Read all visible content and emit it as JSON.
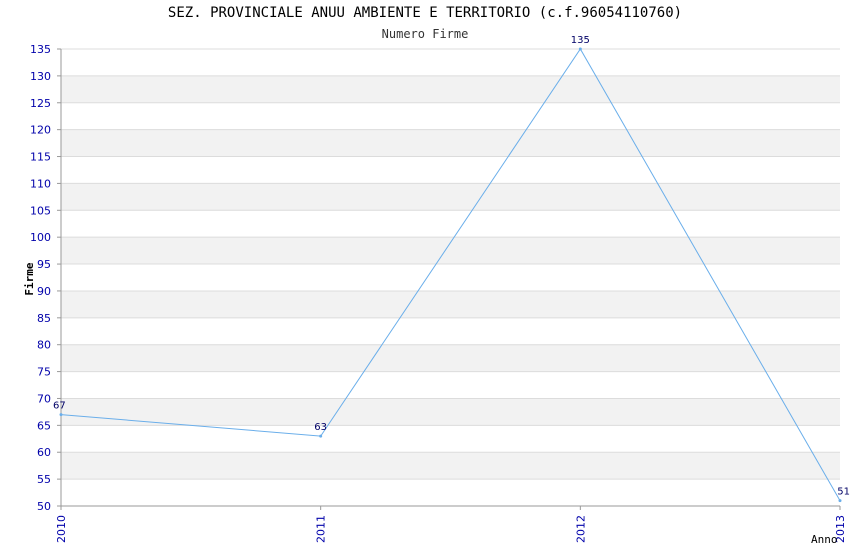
{
  "chart_data": {
    "type": "line",
    "title": "SEZ. PROVINCIALE ANUU AMBIENTE E TERRITORIO (c.f.96054110760)",
    "subtitle": "Numero Firme",
    "xlabel": "Anno",
    "ylabel": "Firme",
    "x": [
      "2010",
      "2011",
      "2012",
      "2013"
    ],
    "series": [
      {
        "values": [
          67,
          63,
          135,
          51
        ]
      }
    ],
    "ylim": [
      50,
      135
    ],
    "yticks": [
      50,
      55,
      60,
      65,
      70,
      75,
      80,
      85,
      90,
      95,
      100,
      105,
      110,
      115,
      120,
      125,
      130,
      135
    ],
    "grid": true,
    "colors": {
      "line": "#6aaeea",
      "band": "#f2f2f2",
      "tick_text": "#0000aa"
    }
  }
}
